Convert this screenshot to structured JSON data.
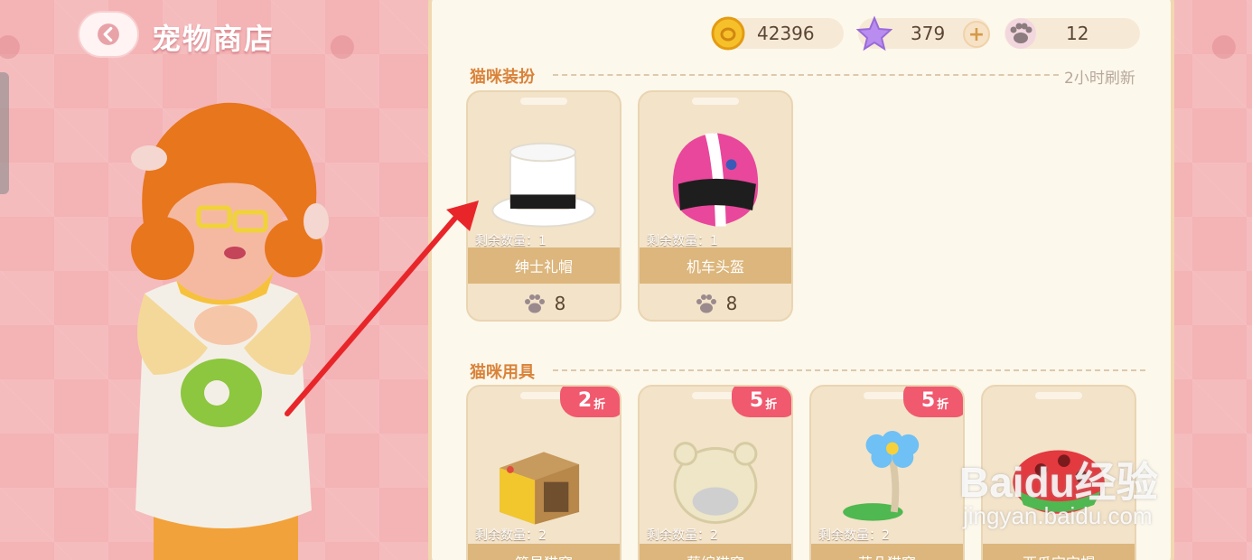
{
  "header": {
    "title": "宠物商店"
  },
  "currency": {
    "coins": "42396",
    "stars": "379",
    "paws": "12"
  },
  "sections": [
    {
      "title": "猫咪装扮",
      "refresh": "2小时刷新",
      "items": [
        {
          "name": "绅士礼帽",
          "stock": "剩余数量：1",
          "price": "8",
          "icon": "top-hat"
        },
        {
          "name": "机车头盔",
          "stock": "剩余数量：1",
          "price": "8",
          "icon": "motorcycle-helmet"
        }
      ]
    },
    {
      "title": "猫咪用具",
      "items": [
        {
          "name": "简易猫窝",
          "stock": "剩余数量：2",
          "discount": "2",
          "discount_unit": "折",
          "icon": "box-cat-bed"
        },
        {
          "name": "藤编猫窝",
          "stock": "剩余数量：2",
          "discount": "5",
          "discount_unit": "折",
          "icon": "rattan-cat-bed"
        },
        {
          "name": "花朵猫窝",
          "stock": "剩余数量：2",
          "discount": "5",
          "discount_unit": "折",
          "icon": "flower-cat-tree"
        },
        {
          "name": "西瓜宝宝帽",
          "stock": "",
          "icon": "mushroom-cat-bed"
        }
      ]
    }
  ],
  "watermark": {
    "brand": "Baidu经验",
    "url": "jingyan.baidu.com"
  },
  "colors": {
    "accent": "#d9833a",
    "discount": "#f0596e",
    "name_bar": "#dcb67c",
    "panel": "#fdf8ec"
  }
}
